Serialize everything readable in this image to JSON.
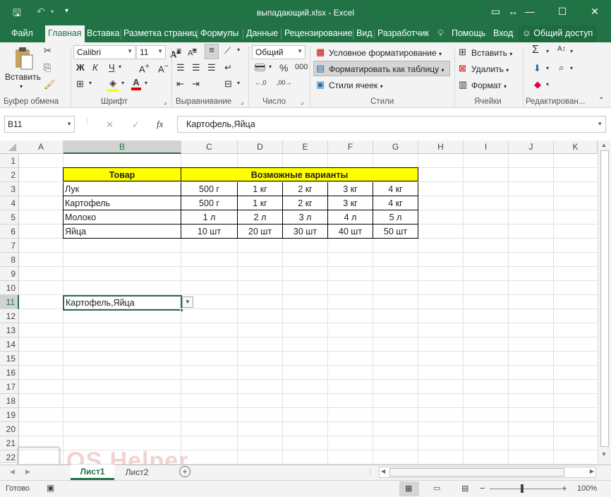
{
  "window": {
    "title": "выпадающий.xlsx - Excel"
  },
  "tabs": [
    "Файл",
    "Главная",
    "Вставка",
    "Разметка страниц",
    "Формулы",
    "Данные",
    "Рецензирование",
    "Вид",
    "Разработчик",
    "Помощь",
    "Вход",
    "Общий доступ"
  ],
  "ribbon": {
    "paste": "Вставить",
    "clipboard_label": "Буфер обмена",
    "font_name": "Calibri",
    "font_size": "11",
    "bold": "Ж",
    "italic": "К",
    "underline": "Ч",
    "font_label": "Шрифт",
    "align_label": "Выравнивание",
    "number_format": "Общий",
    "number_label": "Число",
    "cond_format": "Условное форматирование",
    "format_table": "Форматировать как таблицу",
    "cell_styles": "Стили ячеек",
    "styles_label": "Стили",
    "insert": "Вставить",
    "delete": "Удалить",
    "format": "Формат",
    "cells_label": "Ячейки",
    "editing_label": "Редактирован..."
  },
  "formula_bar": {
    "name_box": "B11",
    "cancel": "✕",
    "enter": "✓",
    "fx": "fx",
    "content": "Картофель,Яйца"
  },
  "columns": [
    "A",
    "B",
    "C",
    "D",
    "E",
    "F",
    "G",
    "H",
    "I",
    "J",
    "K"
  ],
  "rows": [
    "1",
    "2",
    "3",
    "4",
    "5",
    "6",
    "7",
    "8",
    "9",
    "10",
    "11",
    "12",
    "13",
    "14",
    "15",
    "16",
    "17",
    "18",
    "19",
    "20",
    "21",
    "22"
  ],
  "table": {
    "header_item": "Товар",
    "header_variants": "Возможные варианты",
    "rows": [
      {
        "name": "Лук",
        "v": [
          "500 г",
          "1 кг",
          "2 кг",
          "3 кг",
          "4 кг"
        ]
      },
      {
        "name": "Картофель",
        "v": [
          "500 г",
          "1 кг",
          "2 кг",
          "3 кг",
          "4 кг"
        ]
      },
      {
        "name": "Молоко",
        "v": [
          "1 л",
          "2 л",
          "3 л",
          "4 л",
          "5 л"
        ]
      },
      {
        "name": "Яйца",
        "v": [
          "10 шт",
          "20 шт",
          "30 шт",
          "40 шт",
          "50 шт"
        ]
      }
    ],
    "header_color": "#ffff00"
  },
  "active_cell": {
    "value": "Картофель,Яйца"
  },
  "sheets": [
    "Лист1",
    "Лист2"
  ],
  "status": {
    "ready": "Готово",
    "zoom": "100%"
  },
  "watermark": "OS Helper",
  "colors": {
    "accent": "#217346"
  }
}
